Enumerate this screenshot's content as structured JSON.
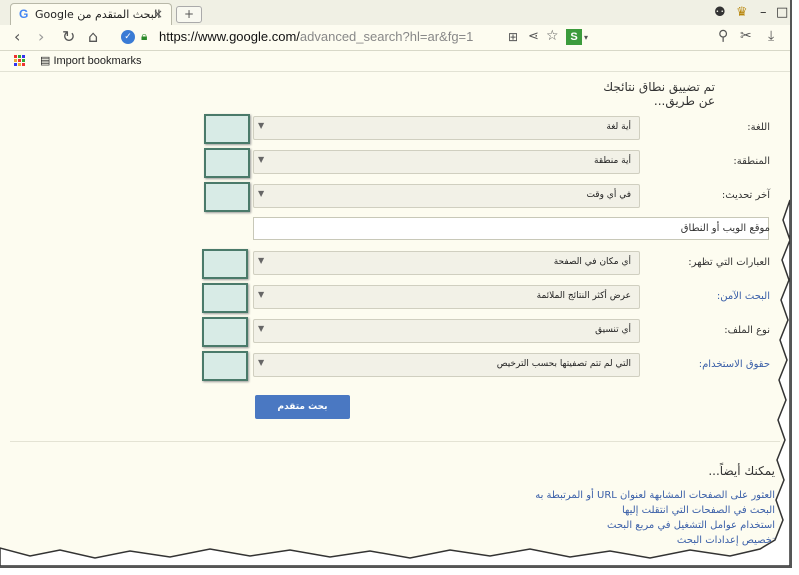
{
  "browser": {
    "tab_title": "Google البحث المتقدم من",
    "tab_close": "×",
    "new_tab": "+",
    "url_main": "https://www.google.com/",
    "url_rest": "advanced_search?hl=ar&fg=1",
    "bookmark": "Import bookmarks",
    "controls": {
      "user": "⌂",
      "min": "–",
      "max": "□"
    }
  },
  "page": {
    "heading": "تم تضييق نطاق نتائجك عن طريق...",
    "rows": [
      {
        "label": "اللغة:",
        "value": "أية لغة",
        "link": false
      },
      {
        "label": "المنطقة:",
        "value": "أية منطقة",
        "link": false
      },
      {
        "label": "آخر تحديث:",
        "value": "في أي وقت",
        "link": false
      },
      {
        "label": "العبارات التي تظهر:",
        "value": "أي مكان في الصفحة",
        "link": false
      },
      {
        "label": "البحث الآمن:",
        "value": "عرض أكثر النتائج الملائمة",
        "link": true
      },
      {
        "label": "نوع الملف:",
        "value": "أي تنسيق",
        "link": false
      },
      {
        "label": "حقوق الاستخدام:",
        "value": "التي لم تتم تصفيتها بحسب الترخيص",
        "link": true
      }
    ],
    "site_label": "موقع الويب أو النطاق",
    "submit_label": "بحث متقدم",
    "also_heading": "يمكنك أيضاً...",
    "also_links": [
      "العثور على الصفحات المشابهة لعنوان URL أو المرتبطة به",
      "البحث في الصفحات التي انتقلت إليها",
      "استخدام عوامل التشغيل في مربع البحث",
      "تخصيص إعدادات البحث"
    ]
  },
  "colors": {
    "accent": "#4a78c2",
    "link": "#3a5fa8",
    "page_bg": "#fdfcf0",
    "highlight_box": "#d8ebe6"
  }
}
